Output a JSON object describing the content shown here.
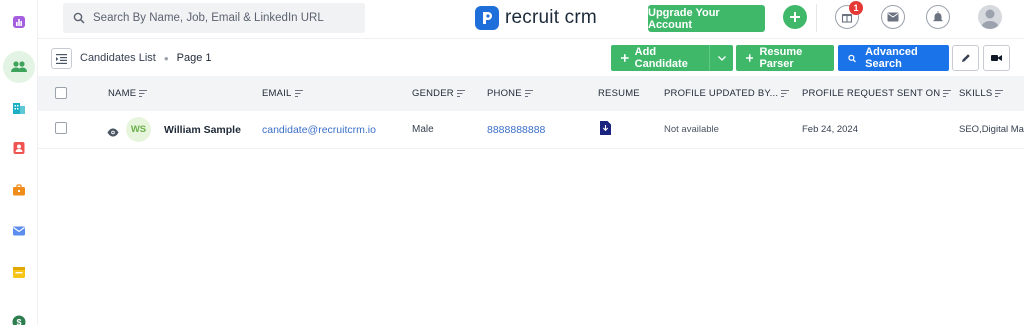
{
  "colors": {
    "green": "#3fb86a",
    "blue": "#1a73e8",
    "link": "#3b6fc9",
    "badge": "#e53935"
  },
  "rail": {
    "icons": [
      "chart-icon",
      "people-icon",
      "building-icon",
      "contact-icon",
      "briefcase-icon",
      "mail-icon",
      "calendar-icon",
      "dollar-icon"
    ]
  },
  "topbar": {
    "search_placeholder": "Search By Name, Job, Email & LinkedIn URL",
    "logo_text": "recruit crm",
    "upgrade_label": "Upgrade Your Account",
    "gift_badge": "1"
  },
  "subheader": {
    "breadcrumb": "Candidates List",
    "page": "Page 1",
    "add_candidate": "Add Candidate",
    "resume_parser": "Resume Parser",
    "advanced_search": "Advanced Search"
  },
  "table": {
    "columns": [
      "NAME",
      "EMAIL",
      "GENDER",
      "PHONE",
      "RESUME",
      "PROFILE UPDATED BY...",
      "PROFILE REQUEST SENT ON",
      "SKILLS"
    ],
    "rows": [
      {
        "initials": "WS",
        "name": "William Sample",
        "email": "candidate@recruitcrm.io",
        "gender": "Male",
        "phone": "8888888888",
        "profile_updated_by": "Not available",
        "profile_request_sent_on": "Feb 24, 2024",
        "skills": "SEO,Digital Mark"
      }
    ]
  }
}
